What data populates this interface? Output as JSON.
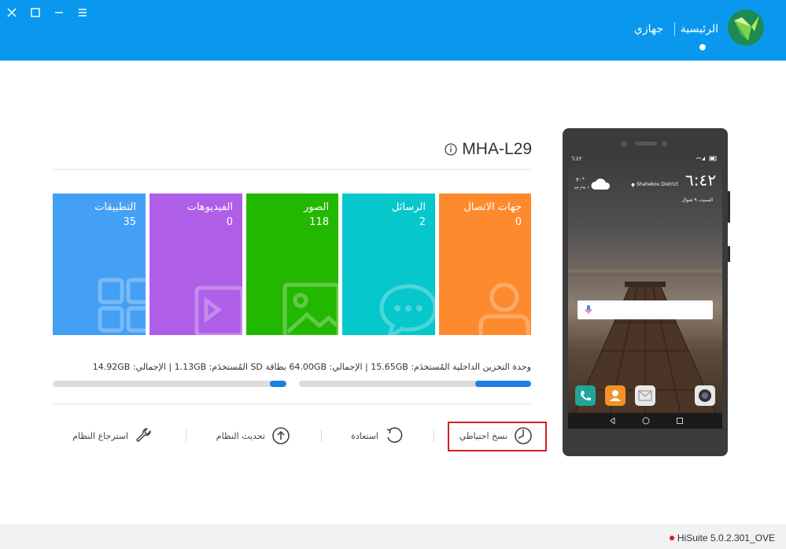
{
  "window": {
    "close_icon": "close-icon",
    "maximize_icon": "maximize-icon",
    "minimize_icon": "minimize-icon",
    "menu_icon": "menu-icon"
  },
  "header": {
    "nav_home": "الرئيسية",
    "nav_my_device": "جهازي",
    "bg_color": "#0a98ef"
  },
  "device": {
    "model": "MHA-L29"
  },
  "tiles": [
    {
      "label": "جهات الاتصال",
      "count": "0",
      "color": "#fe8a2e",
      "icon": "contact-icon"
    },
    {
      "label": "الرسائل",
      "count": "2",
      "color": "#06c7cc",
      "icon": "message-icon"
    },
    {
      "label": "الصور",
      "count": "118",
      "color": "#23b800",
      "icon": "photo-icon"
    },
    {
      "label": "الفيديوهات",
      "count": "0",
      "color": "#ae5ee7",
      "icon": "video-icon"
    },
    {
      "label": "التطبيقات",
      "count": "35",
      "color": "#44a0f5",
      "icon": "apps-icon"
    }
  ],
  "storage": {
    "internal": {
      "label": "وحدة التخزين الداخلية",
      "details": "المُستخدَم: 15.65GB | الإجمالي: 64.00GB",
      "used_fraction": 0.24
    },
    "sd": {
      "label": "بطاقة SD",
      "details": "المُستخدَم: 1.13GB | الإجمالي: 14.92GB",
      "used_fraction": 0.07
    }
  },
  "actions": [
    {
      "label": "نسخ احتياطي",
      "icon": "backup-clock-icon"
    },
    {
      "label": "استعادة",
      "icon": "restore-icon"
    },
    {
      "label": "تحديث النظام",
      "icon": "update-arrow-icon"
    },
    {
      "label": "استرجاع النظام",
      "icon": "wrench-icon"
    }
  ],
  "phone": {
    "status_left": "٦:٤٢",
    "time": "٦:٤٢",
    "location": "Shahekou District",
    "date": "السبت، ٩ شوال",
    "weather_temp": "٣٠°",
    "weather_range": "٣٠°/ ٢٣°"
  },
  "footer": {
    "version": "HiSuite 5.0.2.301_OVE"
  }
}
